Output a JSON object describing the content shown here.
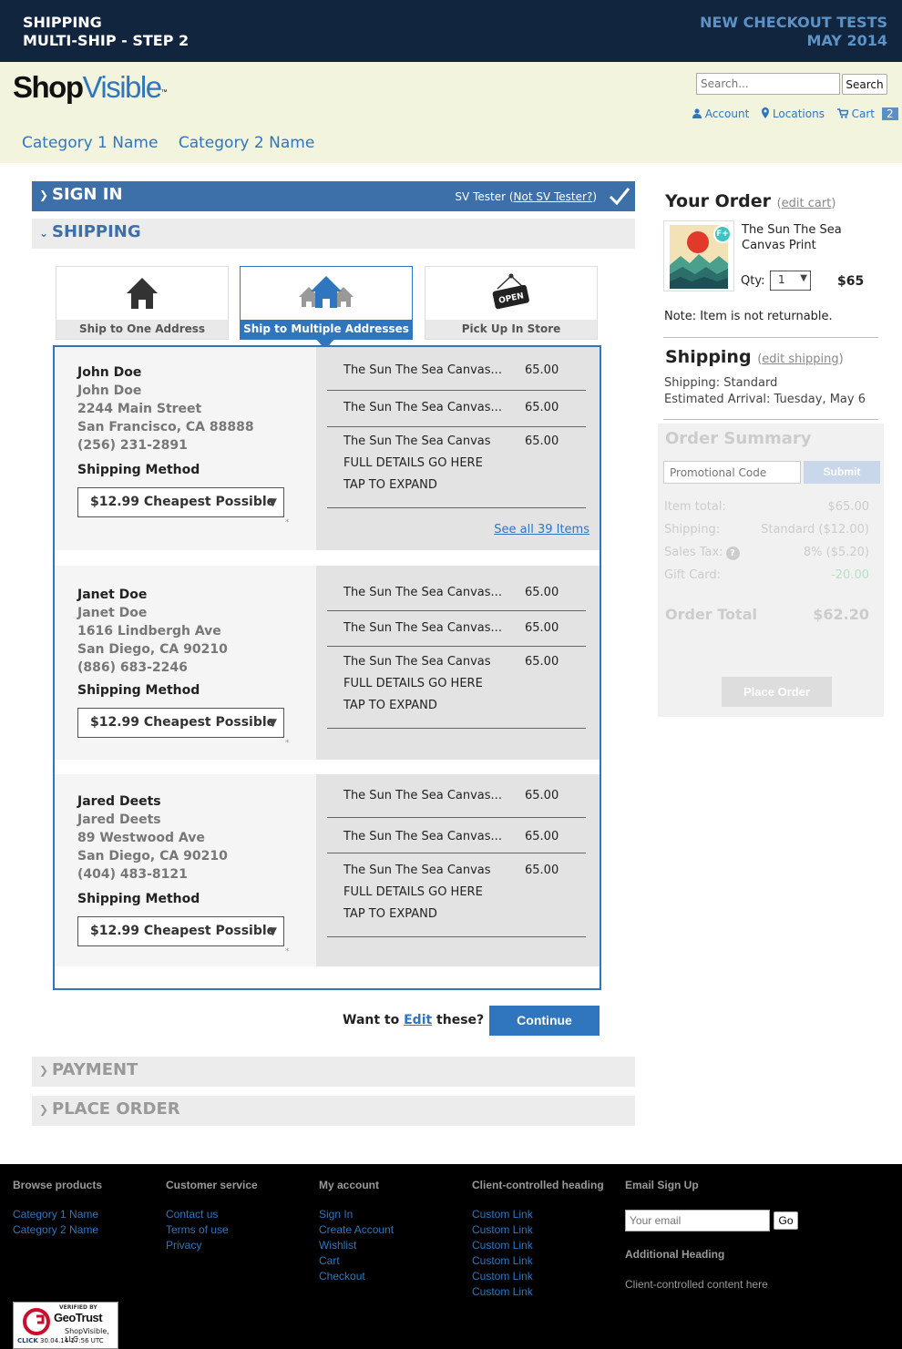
{
  "banner": {
    "left_line1": "SHIPPING",
    "left_line2": "MULTI-SHIP - STEP 2",
    "right_line1": "NEW CHECKOUT TESTS",
    "right_line2": "MAY 2014"
  },
  "logo": {
    "part1": "Shop",
    "part2": "Visible",
    "tm": "™"
  },
  "search": {
    "placeholder": "Search...",
    "button": "Search"
  },
  "account_links": {
    "account": "Account",
    "locations": "Locations",
    "cart": "Cart",
    "cart_count": "2"
  },
  "categories": [
    "Category 1 Name",
    "Category 2 Name"
  ],
  "sections": {
    "signin": {
      "title": "SIGN IN",
      "user_prefix": "SV Tester (",
      "user_link": "Not SV Tester?",
      "user_suffix": ")"
    },
    "shipping": {
      "title": "SHIPPING"
    },
    "payment": {
      "title": "PAYMENT"
    },
    "place_order": {
      "title": "PLACE ORDER"
    }
  },
  "ship_tabs": [
    "Ship to One Address",
    "Ship to Multiple Addresses",
    "Pick Up In Store"
  ],
  "open_sign": "OPEN",
  "shipping_method_label": "Shipping Method",
  "recipients": [
    {
      "name_bold": "John Doe",
      "name": "John Doe",
      "street": "2244 Main Street",
      "city": "San Francisco, CA 88888",
      "phone": "(256) 231-2891",
      "method": "$12.99 Cheapest Possible",
      "items": [
        {
          "name": "The Sun The Sea Canvas...",
          "price": "65.00"
        },
        {
          "name": "The Sun The Sea Canvas...",
          "price": "65.00"
        },
        {
          "name": "The Sun The Sea Canvas",
          "line2": "FULL DETAILS GO HERE",
          "line3": "TAP TO EXPAND",
          "price": "65.00"
        }
      ],
      "see_all": "See all 39 Items"
    },
    {
      "name_bold": "Janet Doe",
      "name": "Janet Doe",
      "street": "1616 Lindbergh Ave",
      "city": "San Diego, CA 90210",
      "phone": "(886) 683-2246",
      "method": "$12.99 Cheapest Possible",
      "items": [
        {
          "name": "The Sun The Sea Canvas...",
          "price": "65.00"
        },
        {
          "name": "The Sun The Sea Canvas...",
          "price": "65.00"
        },
        {
          "name": "The Sun The Sea Canvas",
          "line2": "FULL DETAILS GO HERE",
          "line3": "TAP TO EXPAND",
          "price": "65.00"
        }
      ]
    },
    {
      "name_bold": "Jared Deets",
      "name": "Jared Deets",
      "street": "89 Westwood Ave",
      "city": "San Diego, CA 90210",
      "phone": "(404) 483-8121",
      "method": "$12.99 Cheapest Possible",
      "items": [
        {
          "name": "The Sun The Sea Canvas...",
          "price": "65.00"
        },
        {
          "name": "The Sun The Sea Canvas...",
          "price": "65.00"
        },
        {
          "name": "The Sun The Sea Canvas",
          "line2": "FULL DETAILS GO HERE",
          "line3": "TAP TO EXPAND",
          "price": "65.00"
        }
      ]
    }
  ],
  "edit_prompt": {
    "prefix": "Want to ",
    "link": "Edit",
    "suffix": " these?"
  },
  "continue_label": "Continue",
  "your_order": {
    "title": "Your Order",
    "edit": "edit cart",
    "product": "The Sun The Sea Canvas Print",
    "badge": "F+",
    "qty_label": "Qty:",
    "qty_value": "1",
    "price": "$65",
    "note": "Note: Item is not returnable."
  },
  "shipping_summary": {
    "title": "Shipping",
    "edit": "edit shipping",
    "method": "Shipping: Standard",
    "arrival": "Estimated Arrival: Tuesday, May 6"
  },
  "order_summary": {
    "title": "Order Summary",
    "promo_placeholder": "Promotional Code",
    "promo_button": "Submit",
    "item_total_label": "Item total:",
    "item_total": "$65.00",
    "shipping_label": "Shipping:",
    "shipping_value": "Standard ($12.00)",
    "tax_label": "Sales Tax:",
    "tax_value": "8% ($5.20)",
    "gift_label": "Gift Card:",
    "gift_value": "-20.00",
    "total_label": "Order Total",
    "total_value": "$62.20",
    "place_button": "Place Order"
  },
  "footer": {
    "browse": {
      "heading": "Browse products",
      "links": [
        "Category 1 Name",
        "Category 2 Name"
      ]
    },
    "service": {
      "heading": "Customer service",
      "links": [
        "Contact us",
        "Terms of use",
        "Privacy"
      ]
    },
    "account": {
      "heading": "My account",
      "links": [
        "Sign In",
        "Create Account",
        "Wishlist",
        "Cart",
        "Checkout"
      ]
    },
    "client": {
      "heading": "Client-controlled heading",
      "links": [
        "Custom Link",
        "Custom Link",
        "Custom Link",
        "Custom Link",
        "Custom Link",
        "Custom Link"
      ]
    },
    "email": {
      "heading": "Email Sign Up",
      "placeholder": "Your email",
      "button": "Go"
    },
    "additional": {
      "heading": "Additional Heading",
      "content": "Client-controlled content here"
    }
  },
  "geotrust": {
    "verified": "VERIFIED BY",
    "name": "GeoTrust",
    "company": "ShopVisible, LLC",
    "click": "CLICK",
    "date": "30.04.14 17:56 UTC"
  },
  "colors": {
    "banner_bg": "#12253f",
    "header_bg": "#f3f4de",
    "accent": "#2f76be",
    "signin_bar": "#3d6fa8",
    "footer_bg": "#000000"
  }
}
